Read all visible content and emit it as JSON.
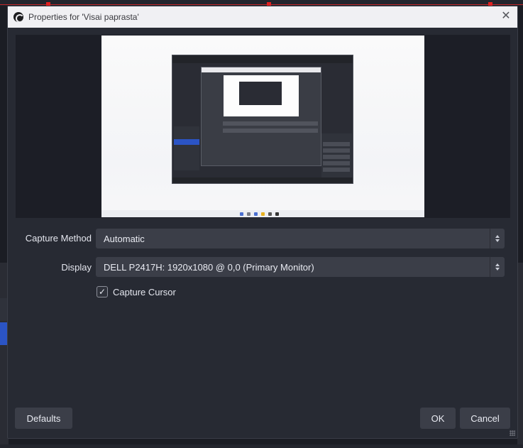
{
  "dialog": {
    "title": "Properties for 'Visai paprasta'",
    "close_icon": "close-icon",
    "app_icon": "obs-logo-icon"
  },
  "form": {
    "capture_method": {
      "label": "Capture Method",
      "value": "Automatic"
    },
    "display": {
      "label": "Display",
      "value": "DELL P2417H: 1920x1080 @ 0,0 (Primary Monitor)"
    },
    "capture_cursor": {
      "label": "Capture Cursor",
      "checked": true
    }
  },
  "buttons": {
    "defaults": "Defaults",
    "ok": "OK",
    "cancel": "Cancel"
  },
  "colors": {
    "dialog_bg": "#272a33",
    "control_bg": "#3b3e48",
    "accent_selection": "#2b54c5",
    "source_bounds": "#e02020"
  }
}
